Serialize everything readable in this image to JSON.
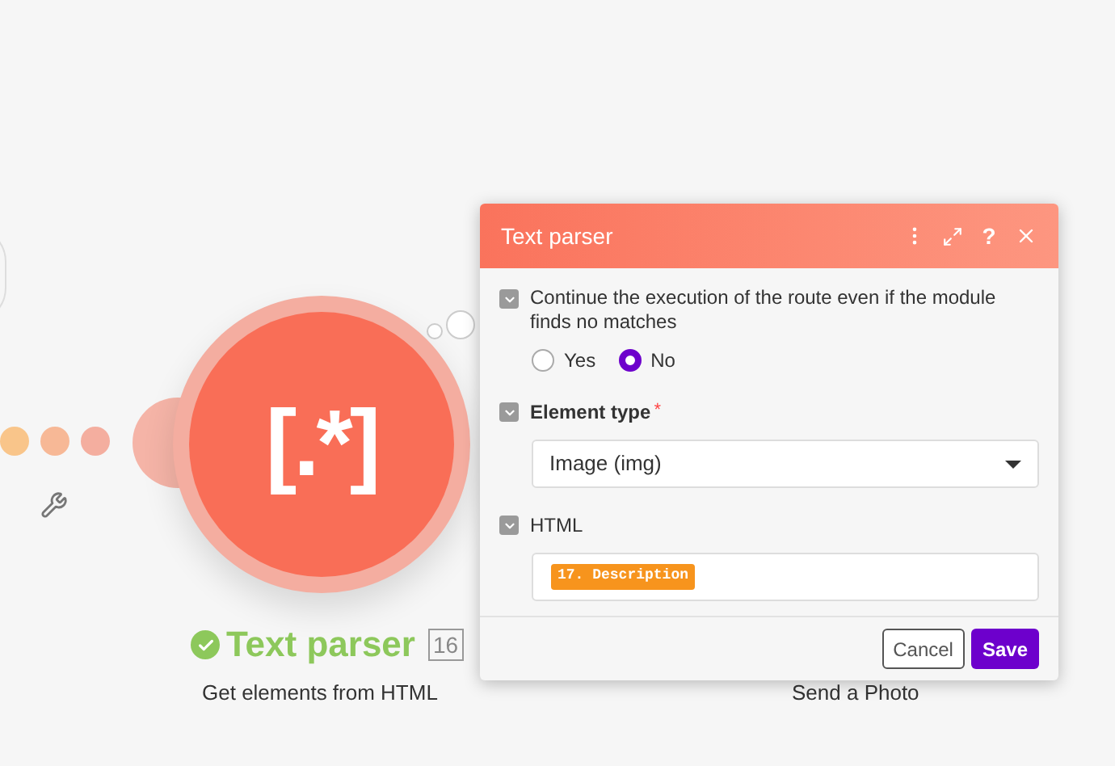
{
  "module": {
    "glyph": "[.*]",
    "title": "Text parser",
    "badge": "16",
    "subtitle": "Get elements from HTML",
    "ok": true
  },
  "next_module": {
    "subtitle": "Send a Photo"
  },
  "dialog": {
    "title": "Text parser",
    "help_glyph": "?",
    "continue_field": {
      "label": "Continue the execution of the route even if the module finds no matches",
      "options": [
        {
          "label": "Yes",
          "selected": false
        },
        {
          "label": "No",
          "selected": true
        }
      ]
    },
    "element_type": {
      "label": "Element type",
      "required_mark": "*",
      "value": "Image (img)"
    },
    "html": {
      "label": "HTML",
      "pill": "17. Description"
    },
    "buttons": [
      {
        "label": "Cancel",
        "kind": "secondary"
      },
      {
        "label": "Save",
        "kind": "primary"
      }
    ]
  }
}
